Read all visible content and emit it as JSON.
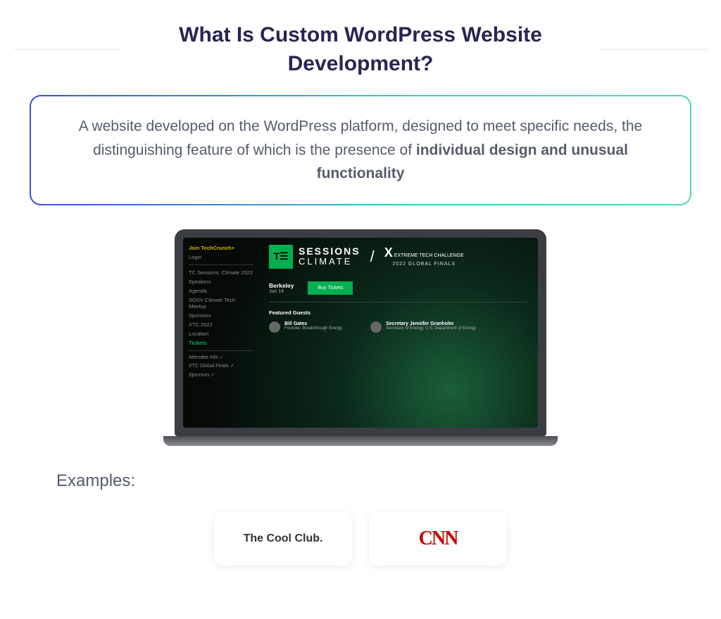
{
  "title": "What Is Custom WordPress Website Development?",
  "definition": {
    "prefix": "A website developed on the WordPress platform, designed to meet specific needs, the distinguishing feature of which is the presence of ",
    "bold": "individual design and unusual functionality"
  },
  "laptop": {
    "sidebar": {
      "join": "Join TechCrunch+",
      "login": "Login",
      "items": [
        "TC Sessions: Climate 2022",
        "Speakers",
        "Agenda",
        "SOSV Climate Tech Meetup",
        "Sponsors",
        "XTC 2022",
        "Location"
      ],
      "active": "Tickets",
      "links": [
        "Attendee Info",
        "XTC Global Finals",
        "Sponsors"
      ]
    },
    "hero": {
      "tc_logo": "T☰",
      "line1": "SESSIONS",
      "line2": "CLIMATE",
      "xtc_top": "EXTREME TECH CHALLENGE",
      "xtc_sub": "2022 GLOBAL FINALS"
    },
    "location": {
      "city": "Berkeley",
      "date": "Jun 14"
    },
    "cta": "Buy Tickets",
    "featured_title": "Featured Guests",
    "guests": [
      {
        "name": "Bill Gates",
        "sub": "Founder, Breakthrough Energy"
      },
      {
        "name": "Secretary Jennifer Granholm",
        "sub": "Secretary of Energy, U.S. Department of Energy"
      }
    ]
  },
  "examples_label": "Examples:",
  "examples": [
    {
      "label": "The Cool Club."
    },
    {
      "label": "CNN"
    }
  ]
}
